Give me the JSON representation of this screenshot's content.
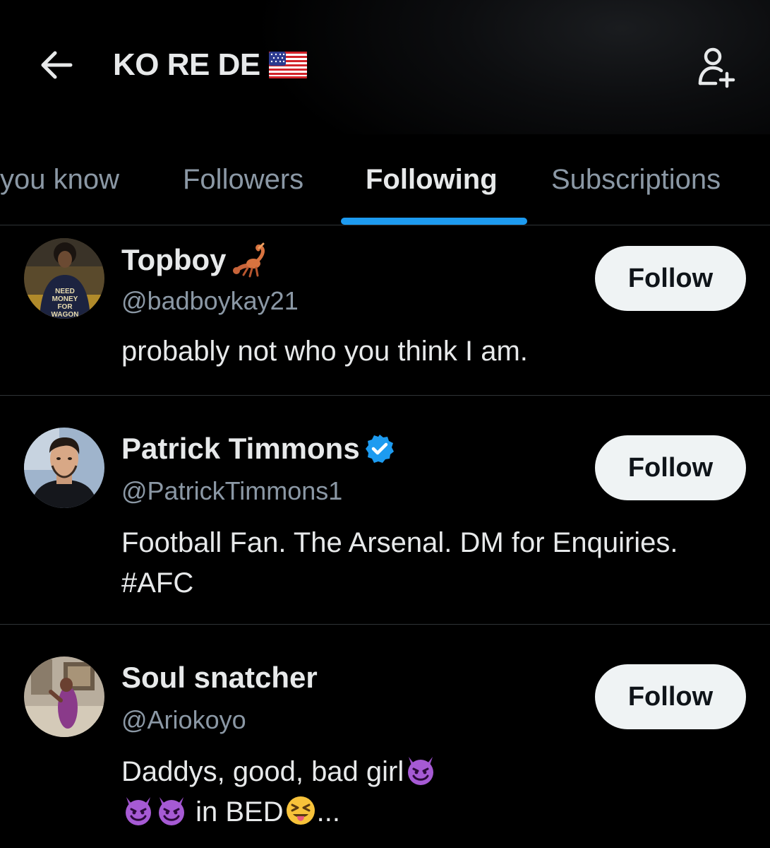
{
  "header": {
    "title": "KO RE DE",
    "flag_icon": "us-flag-icon",
    "back_icon": "arrow-left-icon",
    "add_user_icon": "add-user-icon"
  },
  "tabs": [
    {
      "label": "you know",
      "active": false
    },
    {
      "label": "Followers",
      "active": false
    },
    {
      "label": "Following",
      "active": true
    },
    {
      "label": "Subscriptions",
      "active": false
    }
  ],
  "accent_color": "#1d9bf0",
  "users": [
    {
      "name": "Topboy",
      "name_emoji": "scorpion-icon",
      "handle": "@badboykay21",
      "bio_lines": [
        "probably not who you think I am."
      ],
      "follow_label": "Follow",
      "verified": false
    },
    {
      "name": "Patrick Timmons",
      "handle": "@PatrickTimmons1",
      "bio_lines": [
        "Football Fan. The Arsenal. DM for Enquiries.",
        "#AFC"
      ],
      "follow_label": "Follow",
      "verified": true
    },
    {
      "name": "Soul snatcher",
      "handle": "@Ariokoyo",
      "bio_lines": [
        "Daddys, good, bad girl",
        "in BED",
        "..."
      ],
      "follow_label": "Follow",
      "verified": false
    }
  ]
}
